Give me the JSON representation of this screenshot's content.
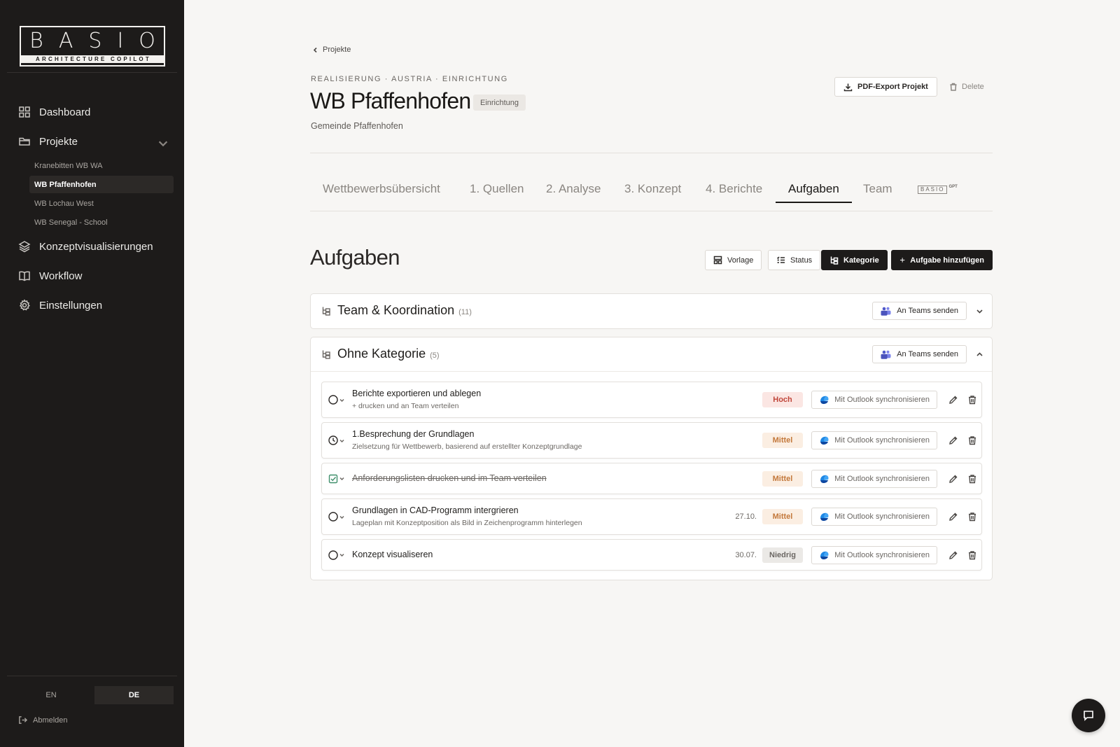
{
  "sidebar": {
    "logo": {
      "main": "BASIO",
      "sub": "ARCHITECTURE COPILOT"
    },
    "nav": [
      {
        "label": "Dashboard",
        "icon": "dashboard-icon"
      },
      {
        "label": "Projekte",
        "icon": "folder-icon"
      },
      {
        "label": "Konzeptvisualisierungen",
        "icon": "layers-icon"
      },
      {
        "label": "Workflow",
        "icon": "book-icon"
      },
      {
        "label": "Einstellungen",
        "icon": "gear-icon"
      }
    ],
    "projects": [
      "Kranebitten WB WA",
      "WB Pfaffenhofen",
      "WB Lochau West",
      "WB Senegal - School"
    ],
    "active_project": "WB Pfaffenhofen",
    "languages": [
      "EN",
      "DE"
    ],
    "active_language": "DE",
    "logout_label": "Abmelden"
  },
  "header": {
    "back_label": "Projekte",
    "breadcrumb": "REALISIERUNG · AUSTRIA · EINRICHTUNG",
    "title": "WB Pfaffenhofen",
    "phase_badge": "Einrichtung",
    "client": "Gemeinde Pfaffenhofen",
    "pdf_export_label": "PDF-Export Projekt",
    "delete_label": "Delete"
  },
  "tabs": [
    {
      "label": "Wettbewerbsübersicht"
    },
    {
      "label": "1. Quellen"
    },
    {
      "label": "2. Analyse"
    },
    {
      "label": "3. Konzept"
    },
    {
      "label": "4. Berichte"
    },
    {
      "label": "Aufgaben"
    },
    {
      "label": "Team"
    }
  ],
  "active_tab": "Aufgaben",
  "gpt_tab": {
    "logo": "BASIO",
    "suffix": "GPT"
  },
  "tasks_section": {
    "title": "Aufgaben",
    "toolbar": {
      "template_label": "Vorlage",
      "status_label": "Status",
      "category_label": "Kategorie",
      "add_label": "Aufgabe hinzufügen"
    },
    "groups": [
      {
        "title": "Team & Koordination",
        "count": "(11)",
        "teams_label": "An Teams senden",
        "expanded": false
      },
      {
        "title": "Ohne Kategorie",
        "count": "(5)",
        "teams_label": "An Teams senden",
        "expanded": true
      }
    ],
    "sync_label": "Mit Outlook synchronisieren",
    "tasks": [
      {
        "title": "Berichte exportieren und ablegen",
        "subtitle": "+ drucken und an Team verteilen",
        "date": "",
        "priority": "Hoch",
        "status": "open"
      },
      {
        "title": "1.Besprechung der Grundlagen",
        "subtitle": "Zielsetzung für Wettbewerb, basierend auf erstellter Konzeptgrundlage",
        "date": "",
        "priority": "Mittel",
        "status": "in-progress"
      },
      {
        "title": "Anforderungslisten drucken und im Team verteilen",
        "subtitle": "",
        "date": "",
        "priority": "Mittel",
        "status": "done"
      },
      {
        "title": "Grundlagen in CAD-Programm intergrieren",
        "subtitle": "Lageplan mit Konzeptposition als Bild in Zeichenprogramm hinterlegen",
        "date": "27.10.",
        "priority": "Mittel",
        "status": "open"
      },
      {
        "title": "Konzept visualiseren",
        "subtitle": "",
        "date": "30.07.",
        "priority": "Niedrig",
        "status": "open"
      }
    ]
  },
  "colors": {
    "sidebar_bg": "#1d1b1a",
    "page_bg": "#f7f6f4",
    "priority_high": "#c0463a",
    "priority_medium": "#c3783b",
    "priority_low": "#6b6763"
  }
}
